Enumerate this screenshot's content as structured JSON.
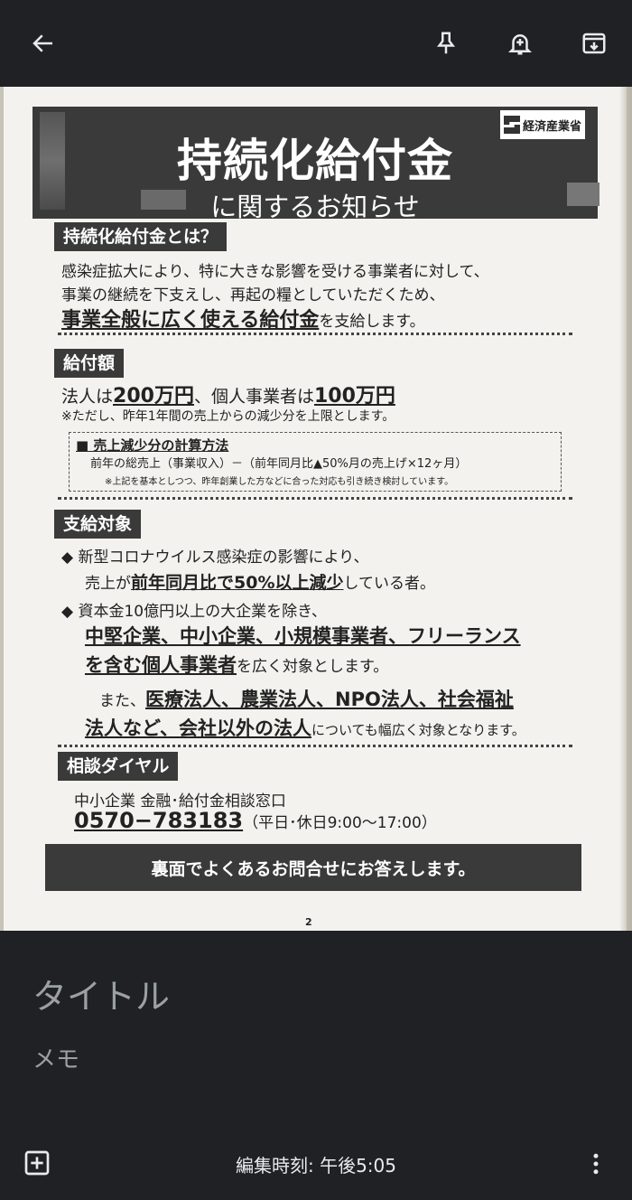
{
  "toolbar": {
    "back_icon": "arrow-back-icon",
    "pin_icon": "pin-icon",
    "reminder_icon": "add-alert-icon",
    "archive_icon": "archive-icon"
  },
  "image": {
    "banner_title": "持続化給付金",
    "banner_subtitle": "に関するお知らせ",
    "logo_text": "経済産業省",
    "section1": {
      "label": "持続化給付金とは？",
      "line1": "感染症拡大により、特に大きな影響を受ける事業者に対して、",
      "line2": "事業の継続を下支えし、再起の糧としていただくため、",
      "line3_bold": "事業全般に広く使える給付金",
      "line3_rest": "を支給します。"
    },
    "section2": {
      "label": "給付額",
      "p1": "法人は",
      "amount1": "200万円",
      "p2": "、個人事業者は",
      "amount2": "100万円",
      "note": "※ただし、昨年1年間の売上からの減少分を上限とします。",
      "calc_title": "■ 売上減少分の計算方法",
      "calc_formula": "前年の総売上（事業収入）－（前年同月比▲50%月の売上げ×12ヶ月）",
      "calc_note": "※上記を基本としつつ、昨年創業した方などに合った対応も引き続き検討しています。"
    },
    "section3": {
      "label": "支給対象",
      "b1_line1": "◆ 新型コロナウイルス感染症の影響により、",
      "b1_line2_a": "売上が",
      "b1_line2_bold": "前年同月比で50%以上減少",
      "b1_line2_b": "している者。",
      "b2_line1": "◆ 資本金10億円以上の大企業を除き、",
      "b2_line2_bold": "中堅企業、中小企業、小規模事業者、フリーランス",
      "b2_line3_bold": "を含む個人事業者",
      "b2_line3_rest": "を広く対象とします。",
      "b3_line1_a": "また、",
      "b3_line1_bold": "医療法人、農業法人、NPO法人、社会福祉",
      "b3_line2_bold": "法人など、会社以外の法人",
      "b3_line2_rest": "についても幅広く対象となります。"
    },
    "section4": {
      "label": "相談ダイヤル",
      "office": "中小企業 金融･給付金相談窓口",
      "phone": "0570−783183",
      "hours": "（平日･休日9:00〜17:00）"
    },
    "footer_banner": "裏面でよくあるお問合せにお答えします。",
    "page_number": "2"
  },
  "note": {
    "title_placeholder": "タイトル",
    "memo_placeholder": "メモ"
  },
  "bottombar": {
    "add_icon": "add-box-icon",
    "edited_time": "編集時刻: 午後5:05",
    "more_icon": "more-vert-icon"
  }
}
